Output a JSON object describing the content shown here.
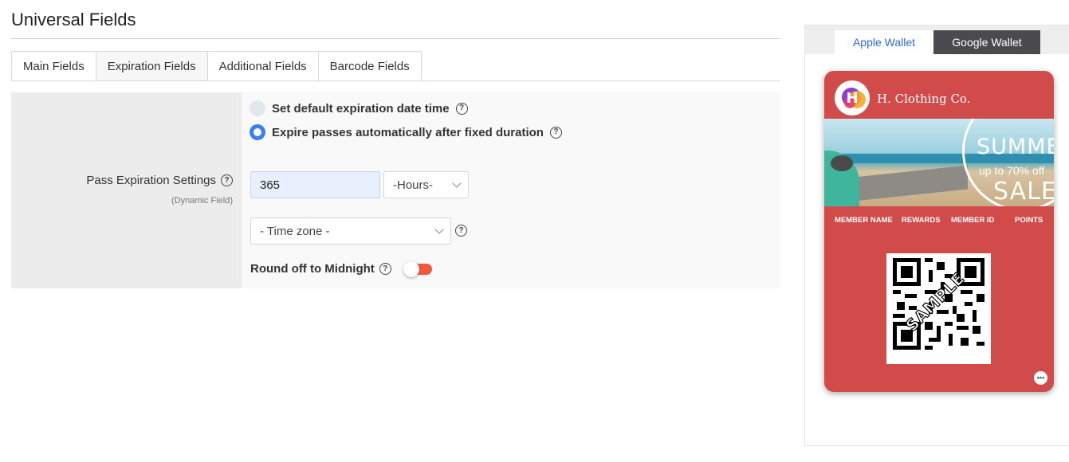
{
  "page": {
    "title": "Universal Fields"
  },
  "tabs": [
    {
      "label": "Main Fields"
    },
    {
      "label": "Expiration Fields"
    },
    {
      "label": "Additional Fields"
    },
    {
      "label": "Barcode Fields"
    }
  ],
  "expiration": {
    "setting_label": "Pass Expiration Settings",
    "setting_sublabel": "(Dynamic Field)",
    "options": [
      {
        "label": "Set default expiration date time",
        "selected": false
      },
      {
        "label": "Expire passes automatically after fixed duration",
        "selected": true
      }
    ],
    "duration_value": "365",
    "unit_select": "-Hours-",
    "timezone_select": "- Time zone -",
    "round_label": "Round off to Midnight",
    "round_enabled": false,
    "help_glyph": "?"
  },
  "preview": {
    "tabs": [
      {
        "label": "Apple Wallet",
        "active": true
      },
      {
        "label": "Google Wallet",
        "active": false
      }
    ],
    "card": {
      "logo_letter": "H",
      "brand_name": "H. Clothing Co.",
      "banner_title": "SUMMER",
      "banner_offer": "up to 70% off",
      "banner_sale": "SALE",
      "fields": [
        "MEMBER NAME",
        "REWARDS",
        "MEMBER ID",
        "POINTS"
      ],
      "barcode_watermark": "SAMPLE",
      "more_glyph": "•••"
    }
  },
  "colors": {
    "accent_blue": "#3a7ff0",
    "card_red": "#d24b4b",
    "toggle_red": "#f1583f",
    "google_tab": "#4b4b4f"
  }
}
